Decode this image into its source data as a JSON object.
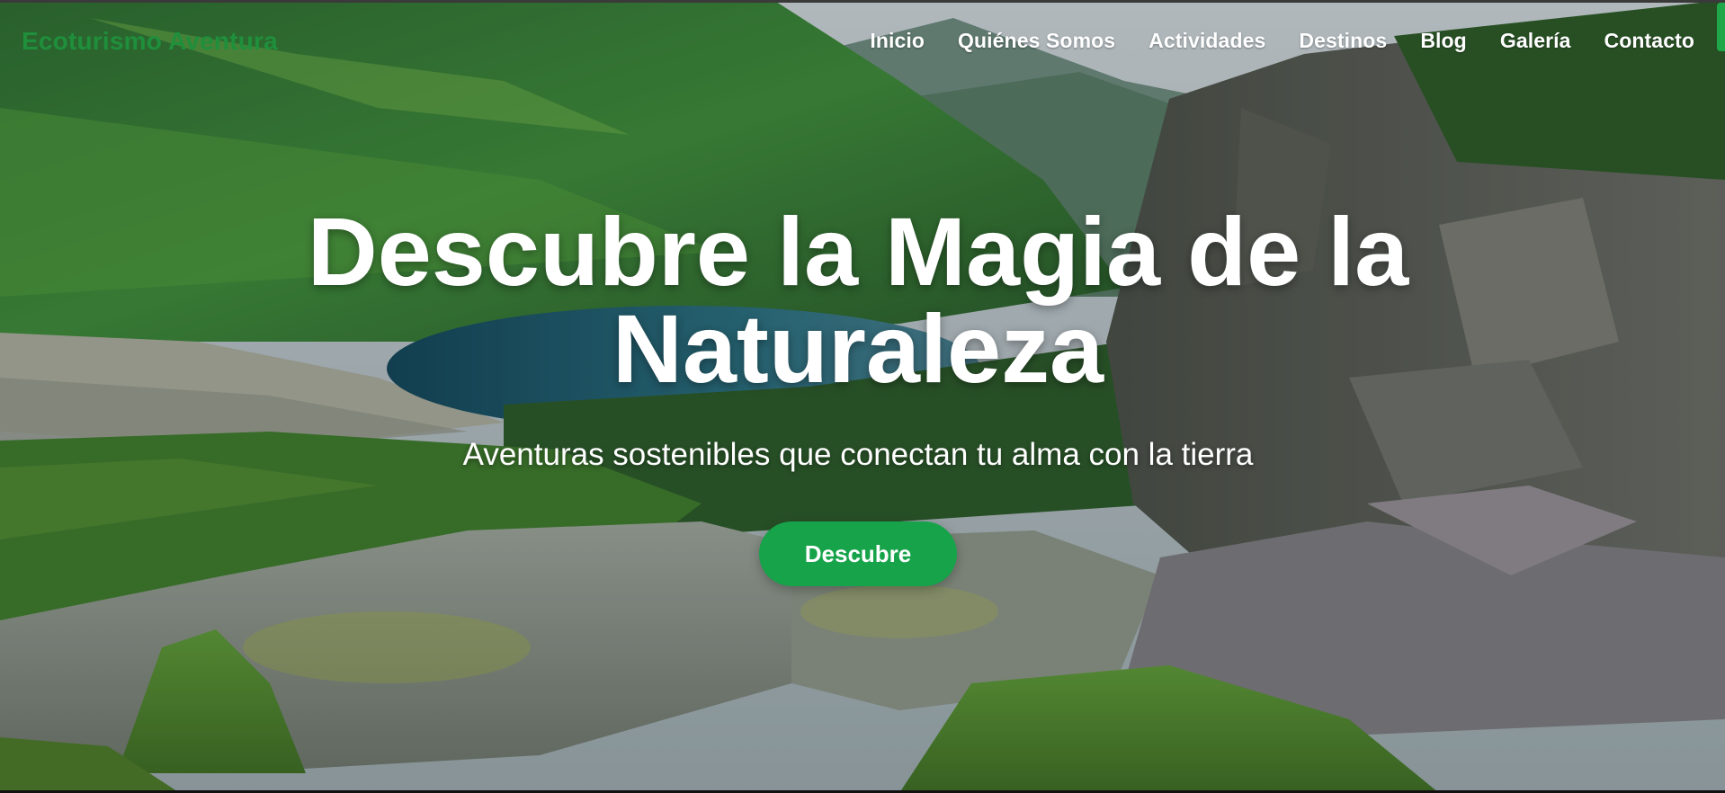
{
  "brand": {
    "name": "Ecoturismo Aventura"
  },
  "nav": {
    "items": [
      {
        "label": "Inicio"
      },
      {
        "label": "Quiénes Somos"
      },
      {
        "label": "Actividades"
      },
      {
        "label": "Destinos"
      },
      {
        "label": "Blog"
      },
      {
        "label": "Galería"
      },
      {
        "label": "Contacto"
      }
    ]
  },
  "hero": {
    "title_line1": "Descubre la Magia de la",
    "title_line2": "Naturaleza",
    "subtitle": "Aventuras sostenibles que conectan tu alma con la tierra",
    "cta_label": "Descubre"
  },
  "colors": {
    "brand": "#1f8f3c",
    "cta_background": "#16a34a",
    "text_on_image": "#ffffff"
  }
}
